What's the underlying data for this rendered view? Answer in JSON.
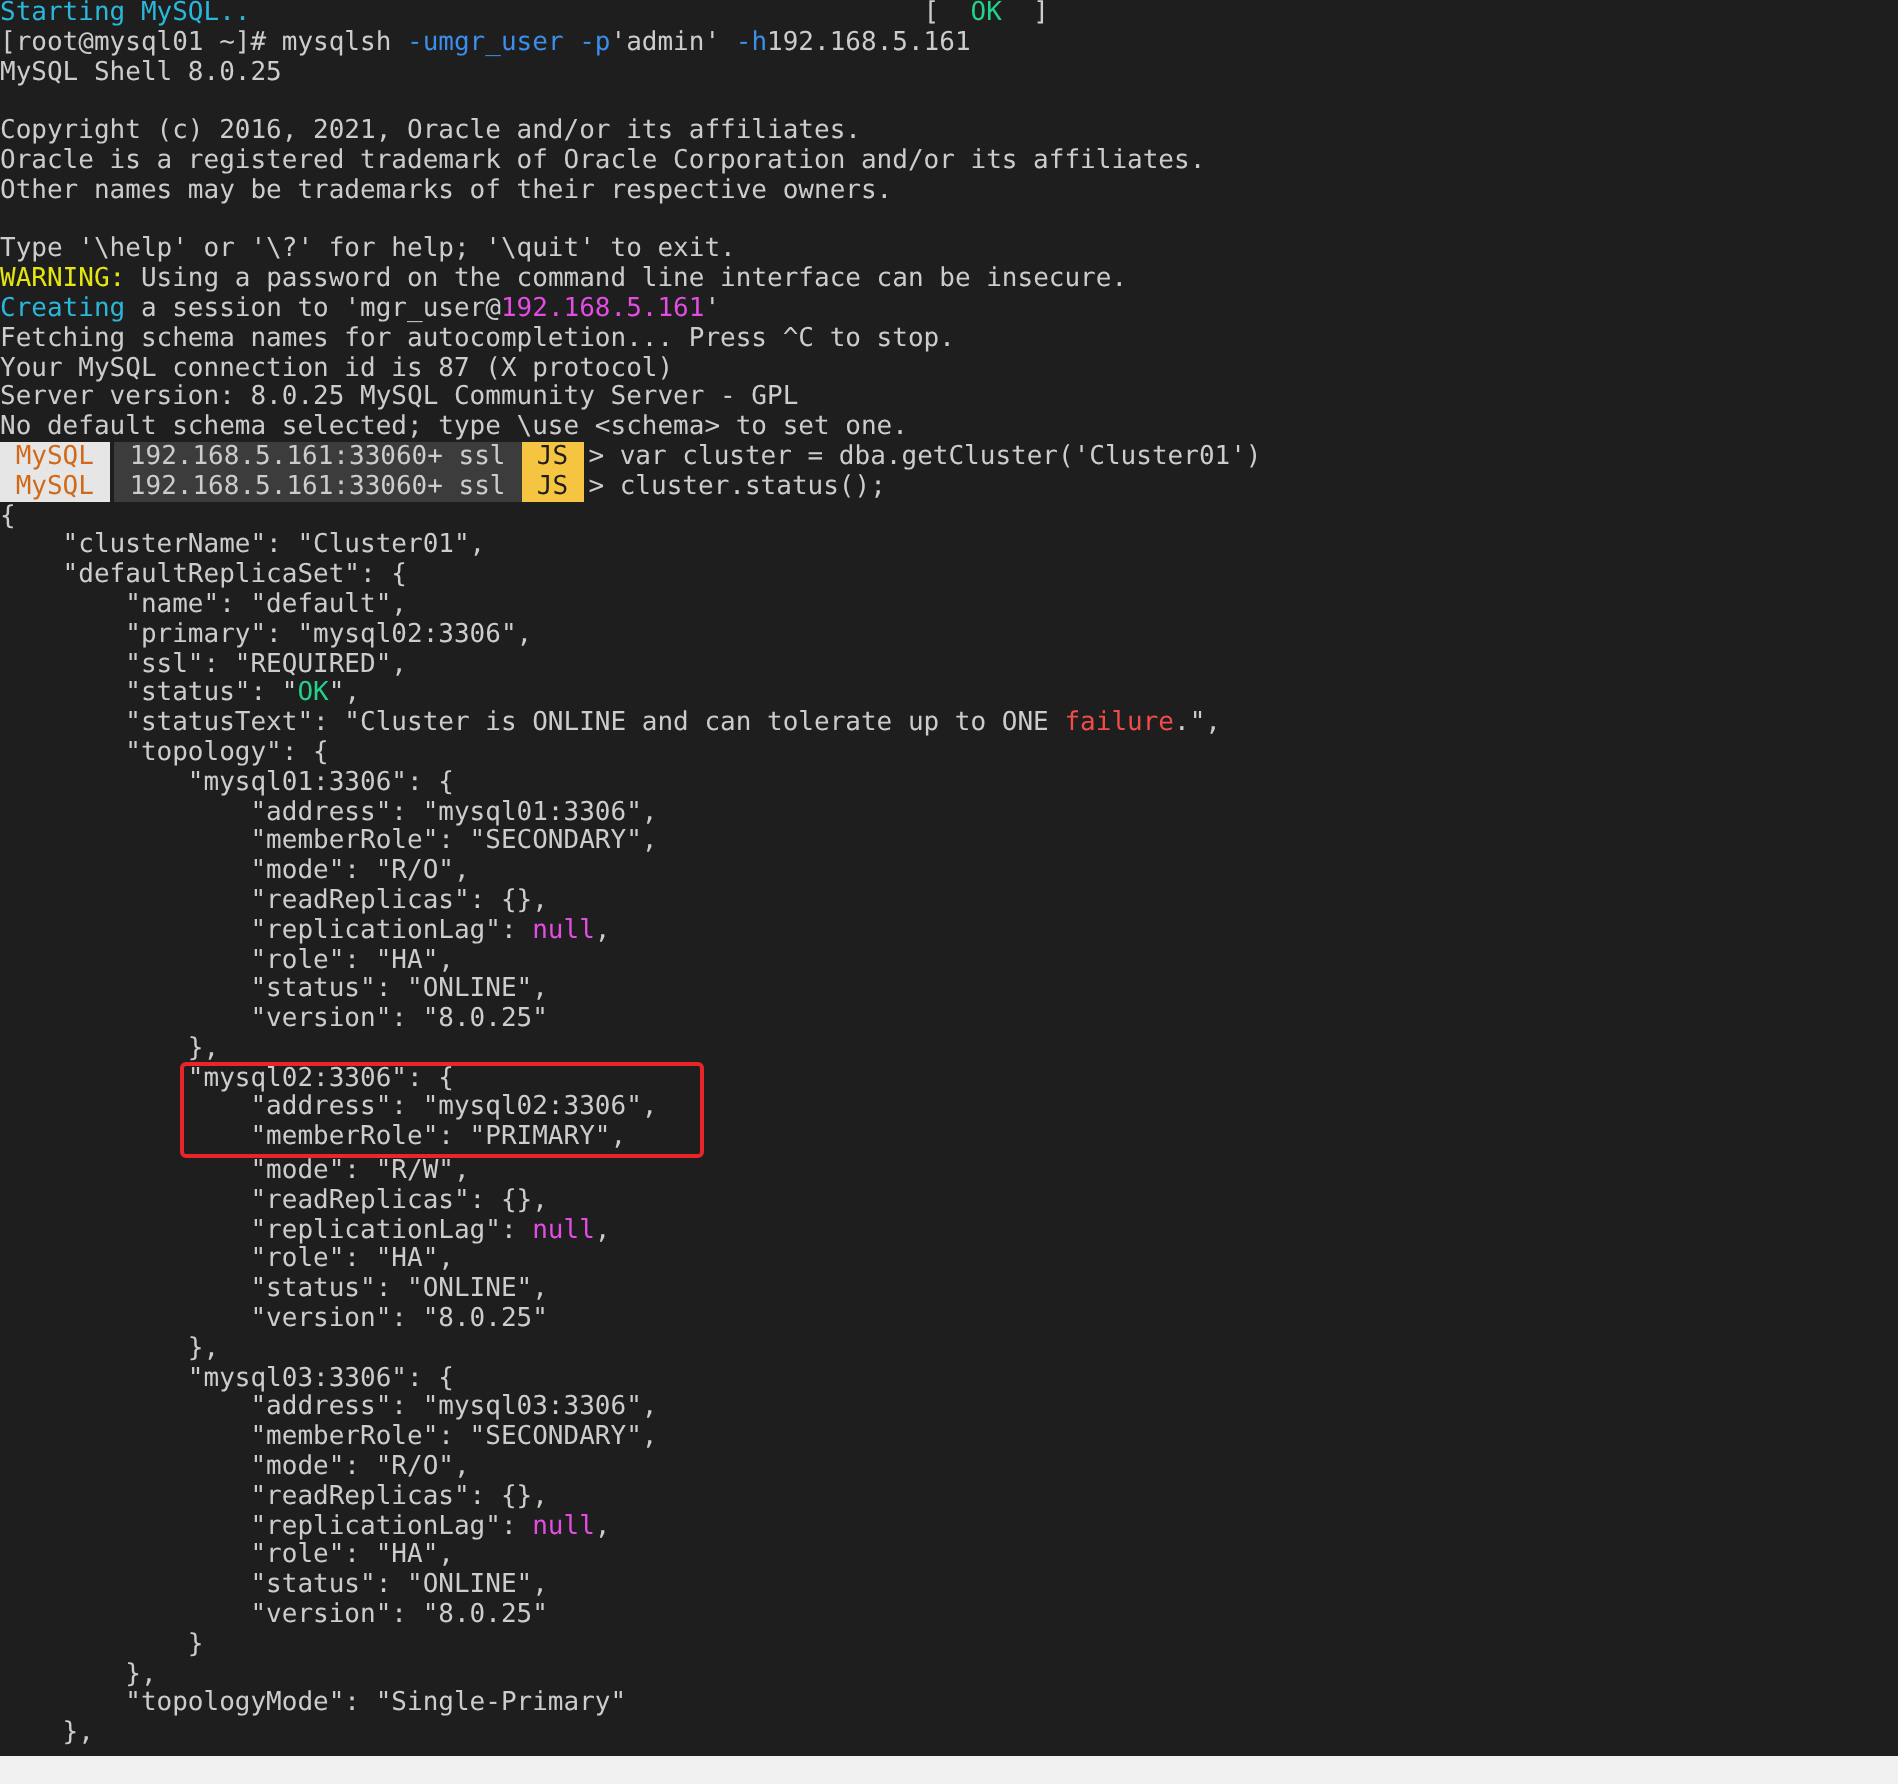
{
  "terminal": {
    "lines": [
      {
        "kind": "text",
        "segments": [
          {
            "kind": "colored",
            "color": "#29b8db",
            "text": "Starting MySQL.."
          },
          {
            "kind": "text",
            "text": "                                           [  "
          },
          {
            "kind": "colored",
            "color": "#23d18b",
            "text": "OK"
          },
          {
            "kind": "text",
            "text": "  ]"
          }
        ]
      },
      {
        "kind": "text",
        "segments": [
          {
            "kind": "text",
            "text": "[root@mysql01 ~]# mysqlsh "
          },
          {
            "kind": "colored",
            "color": "#3b8eea",
            "text": "-umgr_user -p"
          },
          {
            "kind": "text",
            "text": "'admin' "
          },
          {
            "kind": "colored",
            "color": "#3b8eea",
            "text": "-h"
          },
          {
            "kind": "text",
            "text": "192.168.5.161"
          }
        ]
      },
      {
        "kind": "text",
        "segments": [
          {
            "kind": "text",
            "text": "MySQL Shell 8.0.25"
          }
        ]
      },
      {
        "kind": "blank"
      },
      {
        "kind": "text",
        "segments": [
          {
            "kind": "text",
            "text": "Copyright (c) 2016, 2021, Oracle and/or its affiliates."
          }
        ]
      },
      {
        "kind": "text",
        "segments": [
          {
            "kind": "text",
            "text": "Oracle is a registered trademark of Oracle Corporation and/or its affiliates."
          }
        ]
      },
      {
        "kind": "text",
        "segments": [
          {
            "kind": "text",
            "text": "Other names may be trademarks of their respective owners."
          }
        ]
      },
      {
        "kind": "blank"
      },
      {
        "kind": "text",
        "segments": [
          {
            "kind": "text",
            "text": "Type '\\help' or '\\?' for help; '\\quit' to exit."
          }
        ]
      },
      {
        "kind": "text",
        "segments": [
          {
            "kind": "colored",
            "color": "#e5e510",
            "text": "WARNING:"
          },
          {
            "kind": "text",
            "text": " Using a password on the command line interface can be insecure."
          }
        ]
      },
      {
        "kind": "text",
        "segments": [
          {
            "kind": "colored",
            "color": "#29b8db",
            "text": "Creating"
          },
          {
            "kind": "text",
            "text": " a session to 'mgr_user@"
          },
          {
            "kind": "colored",
            "color": "#e44ce4",
            "text": "192.168.5.161"
          },
          {
            "kind": "text",
            "text": "'"
          }
        ]
      },
      {
        "kind": "text",
        "segments": [
          {
            "kind": "text",
            "text": "Fetching schema names for autocompletion... Press ^C to stop."
          }
        ]
      },
      {
        "kind": "text",
        "segments": [
          {
            "kind": "text",
            "text": "Your MySQL connection id is 87 (X protocol)"
          }
        ]
      },
      {
        "kind": "text",
        "segments": [
          {
            "kind": "text",
            "text": "Server version: 8.0.25 MySQL Community Server - GPL"
          }
        ]
      },
      {
        "kind": "text",
        "segments": [
          {
            "kind": "text",
            "text": "No default schema selected; type \\use <schema> to set one."
          }
        ]
      },
      {
        "kind": "prompt",
        "mode": "MySQL",
        "host": "192.168.5.161:33060+ ssl",
        "lang": "JS",
        "command": "> var cluster = dba.getCluster('Cluster01')"
      },
      {
        "kind": "prompt",
        "mode": "MySQL",
        "host": "192.168.5.161:33060+ ssl",
        "lang": "JS",
        "command": "> cluster.status();"
      },
      {
        "kind": "text",
        "segments": [
          {
            "kind": "text",
            "text": "{"
          }
        ]
      },
      {
        "kind": "text",
        "segments": [
          {
            "kind": "text",
            "text": "    \"clusterName\": \"Cluster01\","
          }
        ]
      },
      {
        "kind": "text",
        "segments": [
          {
            "kind": "text",
            "text": "    \"defaultReplicaSet\": {"
          }
        ]
      },
      {
        "kind": "text",
        "segments": [
          {
            "kind": "text",
            "text": "        \"name\": \"default\","
          }
        ]
      },
      {
        "kind": "text",
        "segments": [
          {
            "kind": "text",
            "text": "        \"primary\": \"mysql02:3306\","
          }
        ]
      },
      {
        "kind": "text",
        "segments": [
          {
            "kind": "text",
            "text": "        \"ssl\": \"REQUIRED\","
          }
        ]
      },
      {
        "kind": "text",
        "segments": [
          {
            "kind": "text",
            "text": "        \"status\": \""
          },
          {
            "kind": "colored",
            "color": "#23d18b",
            "text": "OK"
          },
          {
            "kind": "text",
            "text": "\","
          }
        ]
      },
      {
        "kind": "text",
        "segments": [
          {
            "kind": "text",
            "text": "        \"statusText\": \"Cluster is ONLINE and can tolerate up to ONE "
          },
          {
            "kind": "colored",
            "color": "#f14c4c",
            "text": "failure"
          },
          {
            "kind": "text",
            "text": ".\","
          }
        ]
      },
      {
        "kind": "text",
        "segments": [
          {
            "kind": "text",
            "text": "        \"topology\": {"
          }
        ]
      },
      {
        "kind": "text",
        "segments": [
          {
            "kind": "text",
            "text": "            \"mysql01:3306\": {"
          }
        ]
      },
      {
        "kind": "text",
        "segments": [
          {
            "kind": "text",
            "text": "                \"address\": \"mysql01:3306\","
          }
        ]
      },
      {
        "kind": "text",
        "segments": [
          {
            "kind": "text",
            "text": "                \"memberRole\": \"SECONDARY\","
          }
        ]
      },
      {
        "kind": "text",
        "segments": [
          {
            "kind": "text",
            "text": "                \"mode\": \"R/O\","
          }
        ]
      },
      {
        "kind": "text",
        "segments": [
          {
            "kind": "text",
            "text": "                \"readReplicas\": {},"
          }
        ]
      },
      {
        "kind": "text",
        "segments": [
          {
            "kind": "text",
            "text": "                \"replicationLag\": "
          },
          {
            "kind": "colored",
            "color": "#e44ce4",
            "text": "null"
          },
          {
            "kind": "text",
            "text": ","
          }
        ]
      },
      {
        "kind": "text",
        "segments": [
          {
            "kind": "text",
            "text": "                \"role\": \"HA\","
          }
        ]
      },
      {
        "kind": "text",
        "segments": [
          {
            "kind": "text",
            "text": "                \"status\": \"ONLINE\","
          }
        ]
      },
      {
        "kind": "text",
        "segments": [
          {
            "kind": "text",
            "text": "                \"version\": \"8.0.25\""
          }
        ]
      },
      {
        "kind": "text",
        "segments": [
          {
            "kind": "text",
            "text": "            },"
          }
        ]
      },
      {
        "kind": "text",
        "highlighted": true,
        "segments": [
          {
            "kind": "text",
            "text": "            \"mysql02:3306\": {"
          }
        ]
      },
      {
        "kind": "text",
        "highlighted": true,
        "segments": [
          {
            "kind": "text",
            "text": "                \"address\": \"mysql02:3306\","
          }
        ]
      },
      {
        "kind": "text",
        "highlighted": true,
        "segments": [
          {
            "kind": "text",
            "text": "                \"memberRole\": \"PRIMARY\","
          }
        ]
      },
      {
        "kind": "text",
        "segments": [
          {
            "kind": "text",
            "text": "                \"mode\": \"R/W\","
          }
        ]
      },
      {
        "kind": "text",
        "segments": [
          {
            "kind": "text",
            "text": "                \"readReplicas\": {},"
          }
        ]
      },
      {
        "kind": "text",
        "segments": [
          {
            "kind": "text",
            "text": "                \"replicationLag\": "
          },
          {
            "kind": "colored",
            "color": "#e44ce4",
            "text": "null"
          },
          {
            "kind": "text",
            "text": ","
          }
        ]
      },
      {
        "kind": "text",
        "segments": [
          {
            "kind": "text",
            "text": "                \"role\": \"HA\","
          }
        ]
      },
      {
        "kind": "text",
        "segments": [
          {
            "kind": "text",
            "text": "                \"status\": \"ONLINE\","
          }
        ]
      },
      {
        "kind": "text",
        "segments": [
          {
            "kind": "text",
            "text": "                \"version\": \"8.0.25\""
          }
        ]
      },
      {
        "kind": "text",
        "segments": [
          {
            "kind": "text",
            "text": "            },"
          }
        ]
      },
      {
        "kind": "text",
        "segments": [
          {
            "kind": "text",
            "text": "            \"mysql03:3306\": {"
          }
        ]
      },
      {
        "kind": "text",
        "segments": [
          {
            "kind": "text",
            "text": "                \"address\": \"mysql03:3306\","
          }
        ]
      },
      {
        "kind": "text",
        "segments": [
          {
            "kind": "text",
            "text": "                \"memberRole\": \"SECONDARY\","
          }
        ]
      },
      {
        "kind": "text",
        "segments": [
          {
            "kind": "text",
            "text": "                \"mode\": \"R/O\","
          }
        ]
      },
      {
        "kind": "text",
        "segments": [
          {
            "kind": "text",
            "text": "                \"readReplicas\": {},"
          }
        ]
      },
      {
        "kind": "text",
        "segments": [
          {
            "kind": "text",
            "text": "                \"replicationLag\": "
          },
          {
            "kind": "colored",
            "color": "#e44ce4",
            "text": "null"
          },
          {
            "kind": "text",
            "text": ","
          }
        ]
      },
      {
        "kind": "text",
        "segments": [
          {
            "kind": "text",
            "text": "                \"role\": \"HA\","
          }
        ]
      },
      {
        "kind": "text",
        "segments": [
          {
            "kind": "text",
            "text": "                \"status\": \"ONLINE\","
          }
        ]
      },
      {
        "kind": "text",
        "segments": [
          {
            "kind": "text",
            "text": "                \"version\": \"8.0.25\""
          }
        ]
      },
      {
        "kind": "text",
        "segments": [
          {
            "kind": "text",
            "text": "            }"
          }
        ]
      },
      {
        "kind": "text",
        "segments": [
          {
            "kind": "text",
            "text": "        },"
          }
        ]
      },
      {
        "kind": "text",
        "segments": [
          {
            "kind": "text",
            "text": "        \"topologyMode\": \"Single-Primary\""
          }
        ]
      },
      {
        "kind": "text",
        "segments": [
          {
            "kind": "text",
            "text": "    },"
          }
        ]
      }
    ]
  }
}
